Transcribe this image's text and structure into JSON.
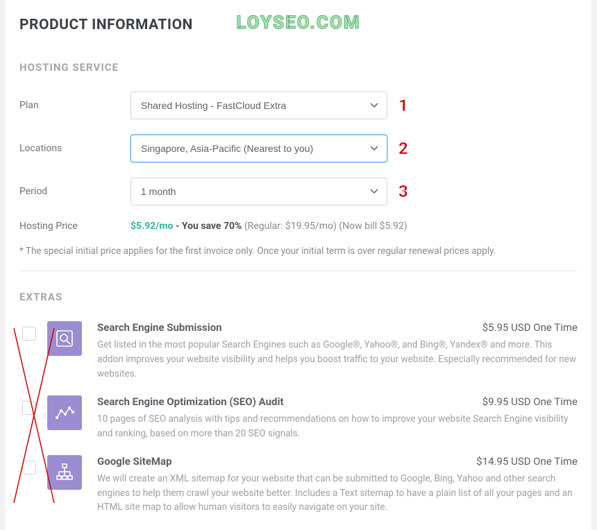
{
  "watermark": "LOYSEO.COM",
  "page_title": "PRODUCT INFORMATION",
  "hosting": {
    "heading": "HOSTING SERVICE",
    "plan_label": "Plan",
    "plan_value": "Shared Hosting - FastCloud Extra",
    "locations_label": "Locations",
    "locations_value": "Singapore, Asia-Pacific (Nearest to you)",
    "period_label": "Period",
    "period_value": "1 month",
    "price_label": "Hosting Price",
    "price_amount": "$5.92/mo",
    "price_save": " - You save 70% ",
    "price_regular": "(Regular: $19.95/mo) (Now bill $5.92)",
    "footnote": "* The special initial price applies for the first invoice only. Once your initial term is over regular renewal prices apply."
  },
  "annotations": {
    "n1": "1",
    "n2": "2",
    "n3": "3"
  },
  "extras": {
    "heading": "EXTRAS",
    "items": [
      {
        "title": "Search Engine Submission",
        "price": "$5.95 USD One Time",
        "desc": "Get listed in the most popular Search Engines such as Google®, Yahoo®, and Bing®, Yandex® and more. This addon improves your website visibility and helps you boost traffic to your website. Especially recommended for new websites.",
        "icon": "search-magnifier-icon"
      },
      {
        "title": "Search Engine Optimization (SEO) Audit",
        "price": "$9.95 USD One Time",
        "desc": "10 pages of SEO analysis with tips and recommendations on how to improve your website Search Engine visibility and ranking, based on more than 20 SEO signals.",
        "icon": "analytics-network-icon"
      },
      {
        "title": "Google SiteMap",
        "price": "$14.95 USD One Time",
        "desc": "We will create an XML sitemap for your website that can be submitted to Google, Bing, Yahoo and other search engines to help them crawl your website better. Includes a Text sitemap to have a plain list of all your pages and an HTML site map to allow human visitors to easily navigate on your site.",
        "icon": "sitemap-tree-icon"
      }
    ]
  }
}
